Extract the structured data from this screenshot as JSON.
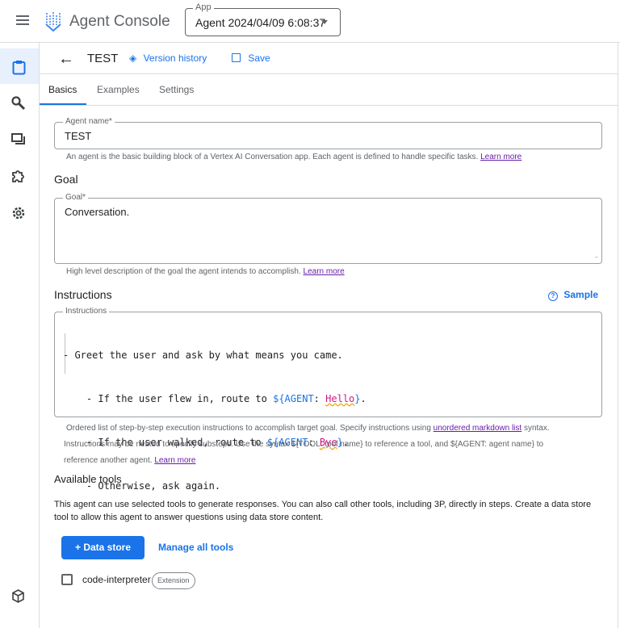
{
  "header": {
    "app_title": "Agent Console",
    "app_select_label": "App",
    "app_select_value": "Agent 2024/04/09 6:08:37"
  },
  "sidebar": {
    "items": [
      "clipboard-icon",
      "wrench-icon",
      "chat-icon",
      "puzzle-icon",
      "gear-icon",
      "cube-icon"
    ]
  },
  "page": {
    "title": "TEST",
    "version_history": "Version history",
    "save": "Save"
  },
  "tabs": [
    {
      "label": "Basics"
    },
    {
      "label": "Examples"
    },
    {
      "label": "Settings"
    }
  ],
  "agent_name": {
    "label": "Agent name*",
    "value": "TEST",
    "helper": "An agent is the basic building block of a Vertex AI Conversation app. Each agent is defined to handle specific tasks.",
    "learn_more": "Learn more"
  },
  "goal": {
    "heading": "Goal",
    "label": "Goal*",
    "value": "Conversation.",
    "helper": "High level description of the goal the agent intends to accomplish.",
    "learn_more": "Learn more"
  },
  "instructions": {
    "heading": "Instructions",
    "sample": "Sample",
    "label": "Instructions",
    "line1": "- Greet the user and ask by what means you came.",
    "line2_pre": "  - If the user flew in, route to ",
    "line2_var": "${AGENT",
    "line2_colon": ": ",
    "line2_name": "Hello",
    "line2_end": "}",
    "line3_pre": "  - If the user walked, route to ",
    "line3_var": "${AGENT",
    "line3_colon": ": ",
    "line3_name": "Bye",
    "line3_end": "}",
    "line4": "  - Otherwise, ask again.",
    "helper1": "Ordered list of step-by-step execution instructions to accomplish target goal. Specify instructions using",
    "helper_link": "unordered markdown list",
    "helper2": "syntax.",
    "helper3": "Instructions may be nested to specify substeps. Use the syntax ${TOOL: tool name} to reference a tool, and ${AGENT: agent name} to",
    "helper4": "reference another agent.",
    "learn_more": "Learn more"
  },
  "tools": {
    "heading": "Available tools",
    "description": "This agent can use selected tools to generate responses. You can also call other tools, including 3P, directly in steps. Create a data store tool to allow this agent to answer questions using data store content.",
    "data_store_button": "+ Data store",
    "manage_link": "Manage all tools",
    "items": [
      {
        "name": "code-interpreter",
        "badge": "Extension",
        "checked": false
      }
    ]
  },
  "colors": {
    "accent": "#1a73e8",
    "active_bg": "#e8f0fe"
  }
}
